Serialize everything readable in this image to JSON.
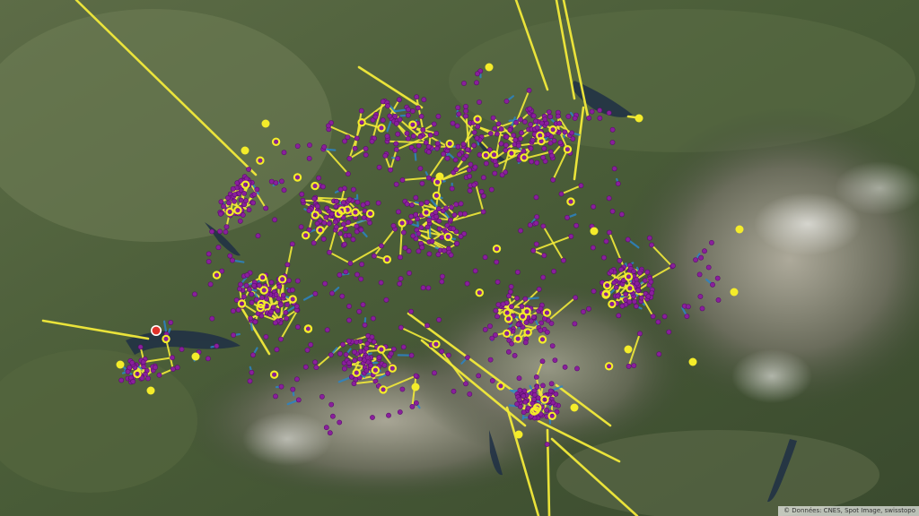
{
  "map": {
    "attribution_icon": "copyright-icon",
    "attribution": "© Données: CNES, Spot Image, swisstopo"
  },
  "colors": {
    "link": "#f2ea3a",
    "node_fill": "#8a1f9c",
    "node_stroke": "#5a0e6e",
    "station": "#f4ec2a",
    "flow": "#2c84c6",
    "highlight": "#e0322b"
  }
}
